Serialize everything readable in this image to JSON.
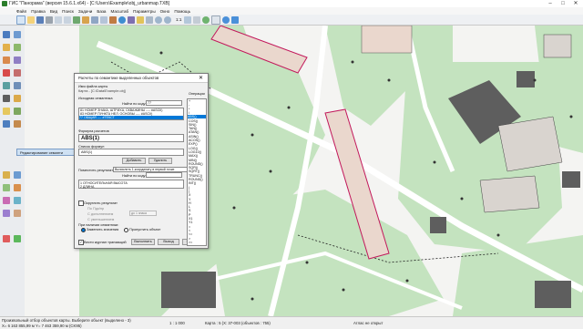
{
  "window": {
    "title": "ГИС \"Панорама\" (версия 15.6.1.x64) - [С:\\Users\\Example\\obj_urbanmap.TXB]",
    "minimize": "–",
    "maximize": "□",
    "close": "✕"
  },
  "menu": [
    "Файл",
    "Правка",
    "Вид",
    "Поиск",
    "Задачи",
    "База",
    "Масштаб",
    "Параметры",
    "Окно",
    "Помощь"
  ],
  "toolbar": {
    "zoom_label": "1:1"
  },
  "side_panel": {
    "label": "Редактирование семанти"
  },
  "dialog": {
    "title": "Расчеты по семантике выделенных объектов",
    "map_name_label": "Имя файла карты",
    "map_name_value": "Карта - [С:\\Data\\Example.obj]",
    "source_sem_label": "Исходная семантика",
    "find_by_code_label": "Найти по коду",
    "find_by_code_value": "77",
    "semantics_rows": [
      "81   НОМЕР ЗНАКА, ШТРИХА, СКВАЖИНЫ ---- #ASCII)",
      "83   НОМЕР ПУНКТА НЕЛ. ОСНОВЫ ---- #ASCII)",
      "77   ОБЩИЙ  ---- #ТЕКСТ"
    ],
    "formula_label": "Формула расчетов",
    "formula_value": "ABS(1)",
    "formula_list_label": "Список формул",
    "formula_list_item": "ABS(1)",
    "add_button": "Добавить",
    "delete_button": "Удалить",
    "place_result_label": "Поместить результат в",
    "place_result_dropdown": "Вычислить 1-координату в первой точке",
    "find_by_code2": "Найти по коду",
    "result_rows": [
      "1    ОТНОСИТЕЛЬНАЯ ВЫСОТА",
      "2    ДЛИНА"
    ],
    "round_result": "Округлить результат",
    "by_rule": "По Пдк/нр",
    "by_digits": "С дополнением",
    "to_integer": "С уменьшением",
    "fraction_label": "до 1 знака",
    "on_existing_label": "При наличии семантики:",
    "replace_values": "Заменить значения",
    "skip_object": "Пропустить объект",
    "keep_log": "Вести журнал транзакций",
    "execute_button": "Выполнить",
    "exit_button": "Выход",
    "help_button": "Помощь"
  },
  "operations": {
    "label": "Операции",
    "items": [
      "+",
      "-",
      "*",
      "/",
      "ABS()",
      "COS()",
      "SIN()",
      "TAN()",
      "ATAN()",
      "ASIN()",
      "ACOS()",
      "EXP()",
      "LOG()",
      "LOG10()",
      "MAX()",
      "MIN()",
      "ROUND()",
      "SQR()",
      "SQRT()",
      "TRUNC()",
      "ROUND()",
      "INT()",
      "(",
      ")",
      "X",
      "Y",
      "H",
      "L",
      "S",
      "P",
      "X1",
      "Y1",
      "=",
      "<",
      "<=",
      ">",
      ">="
    ],
    "selected": 4
  },
  "status": {
    "left_text": "Произвольный отбор объектов карты. Выберите объект (выделено - 3)",
    "coords": "X= 6 163 855,99 м   Y= 7 463 359,90 м  (CK95)",
    "scale_info": "1 : 1 000",
    "map_info": "Карта : 5 (Х: 37-003   (объектов : 755)",
    "atlas": "Атлас не открыт"
  },
  "colors": {
    "map_green": "#c4e3bf",
    "road_white": "#ffffff",
    "building": "#ead7cd",
    "building_dark": "#5e5e5e",
    "selection_blue": "#0078d7",
    "pink_outline": "#c2185b",
    "dialog_bg": "#f0f0f0"
  }
}
